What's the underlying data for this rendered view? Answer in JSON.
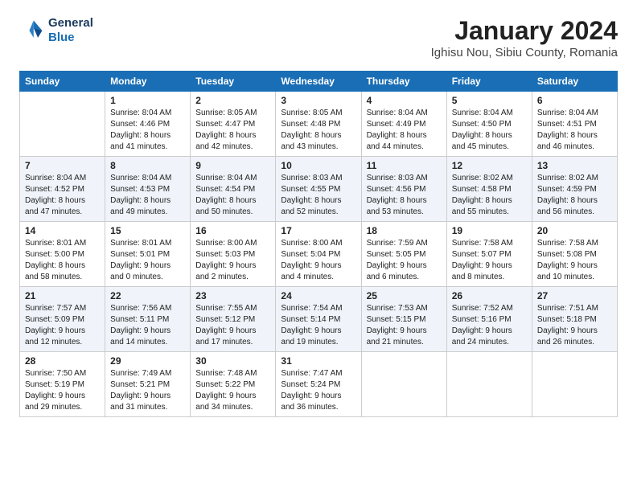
{
  "header": {
    "logo_line1": "General",
    "logo_line2": "Blue",
    "month_title": "January 2024",
    "location": "Ighisu Nou, Sibiu County, Romania"
  },
  "days_of_week": [
    "Sunday",
    "Monday",
    "Tuesday",
    "Wednesday",
    "Thursday",
    "Friday",
    "Saturday"
  ],
  "weeks": [
    [
      {
        "day": "",
        "content": ""
      },
      {
        "day": "1",
        "content": "Sunrise: 8:04 AM\nSunset: 4:46 PM\nDaylight: 8 hours\nand 41 minutes."
      },
      {
        "day": "2",
        "content": "Sunrise: 8:05 AM\nSunset: 4:47 PM\nDaylight: 8 hours\nand 42 minutes."
      },
      {
        "day": "3",
        "content": "Sunrise: 8:05 AM\nSunset: 4:48 PM\nDaylight: 8 hours\nand 43 minutes."
      },
      {
        "day": "4",
        "content": "Sunrise: 8:04 AM\nSunset: 4:49 PM\nDaylight: 8 hours\nand 44 minutes."
      },
      {
        "day": "5",
        "content": "Sunrise: 8:04 AM\nSunset: 4:50 PM\nDaylight: 8 hours\nand 45 minutes."
      },
      {
        "day": "6",
        "content": "Sunrise: 8:04 AM\nSunset: 4:51 PM\nDaylight: 8 hours\nand 46 minutes."
      }
    ],
    [
      {
        "day": "7",
        "content": "Sunrise: 8:04 AM\nSunset: 4:52 PM\nDaylight: 8 hours\nand 47 minutes."
      },
      {
        "day": "8",
        "content": "Sunrise: 8:04 AM\nSunset: 4:53 PM\nDaylight: 8 hours\nand 49 minutes."
      },
      {
        "day": "9",
        "content": "Sunrise: 8:04 AM\nSunset: 4:54 PM\nDaylight: 8 hours\nand 50 minutes."
      },
      {
        "day": "10",
        "content": "Sunrise: 8:03 AM\nSunset: 4:55 PM\nDaylight: 8 hours\nand 52 minutes."
      },
      {
        "day": "11",
        "content": "Sunrise: 8:03 AM\nSunset: 4:56 PM\nDaylight: 8 hours\nand 53 minutes."
      },
      {
        "day": "12",
        "content": "Sunrise: 8:02 AM\nSunset: 4:58 PM\nDaylight: 8 hours\nand 55 minutes."
      },
      {
        "day": "13",
        "content": "Sunrise: 8:02 AM\nSunset: 4:59 PM\nDaylight: 8 hours\nand 56 minutes."
      }
    ],
    [
      {
        "day": "14",
        "content": "Sunrise: 8:01 AM\nSunset: 5:00 PM\nDaylight: 8 hours\nand 58 minutes."
      },
      {
        "day": "15",
        "content": "Sunrise: 8:01 AM\nSunset: 5:01 PM\nDaylight: 9 hours\nand 0 minutes."
      },
      {
        "day": "16",
        "content": "Sunrise: 8:00 AM\nSunset: 5:03 PM\nDaylight: 9 hours\nand 2 minutes."
      },
      {
        "day": "17",
        "content": "Sunrise: 8:00 AM\nSunset: 5:04 PM\nDaylight: 9 hours\nand 4 minutes."
      },
      {
        "day": "18",
        "content": "Sunrise: 7:59 AM\nSunset: 5:05 PM\nDaylight: 9 hours\nand 6 minutes."
      },
      {
        "day": "19",
        "content": "Sunrise: 7:58 AM\nSunset: 5:07 PM\nDaylight: 9 hours\nand 8 minutes."
      },
      {
        "day": "20",
        "content": "Sunrise: 7:58 AM\nSunset: 5:08 PM\nDaylight: 9 hours\nand 10 minutes."
      }
    ],
    [
      {
        "day": "21",
        "content": "Sunrise: 7:57 AM\nSunset: 5:09 PM\nDaylight: 9 hours\nand 12 minutes."
      },
      {
        "day": "22",
        "content": "Sunrise: 7:56 AM\nSunset: 5:11 PM\nDaylight: 9 hours\nand 14 minutes."
      },
      {
        "day": "23",
        "content": "Sunrise: 7:55 AM\nSunset: 5:12 PM\nDaylight: 9 hours\nand 17 minutes."
      },
      {
        "day": "24",
        "content": "Sunrise: 7:54 AM\nSunset: 5:14 PM\nDaylight: 9 hours\nand 19 minutes."
      },
      {
        "day": "25",
        "content": "Sunrise: 7:53 AM\nSunset: 5:15 PM\nDaylight: 9 hours\nand 21 minutes."
      },
      {
        "day": "26",
        "content": "Sunrise: 7:52 AM\nSunset: 5:16 PM\nDaylight: 9 hours\nand 24 minutes."
      },
      {
        "day": "27",
        "content": "Sunrise: 7:51 AM\nSunset: 5:18 PM\nDaylight: 9 hours\nand 26 minutes."
      }
    ],
    [
      {
        "day": "28",
        "content": "Sunrise: 7:50 AM\nSunset: 5:19 PM\nDaylight: 9 hours\nand 29 minutes."
      },
      {
        "day": "29",
        "content": "Sunrise: 7:49 AM\nSunset: 5:21 PM\nDaylight: 9 hours\nand 31 minutes."
      },
      {
        "day": "30",
        "content": "Sunrise: 7:48 AM\nSunset: 5:22 PM\nDaylight: 9 hours\nand 34 minutes."
      },
      {
        "day": "31",
        "content": "Sunrise: 7:47 AM\nSunset: 5:24 PM\nDaylight: 9 hours\nand 36 minutes."
      },
      {
        "day": "",
        "content": ""
      },
      {
        "day": "",
        "content": ""
      },
      {
        "day": "",
        "content": ""
      }
    ]
  ]
}
